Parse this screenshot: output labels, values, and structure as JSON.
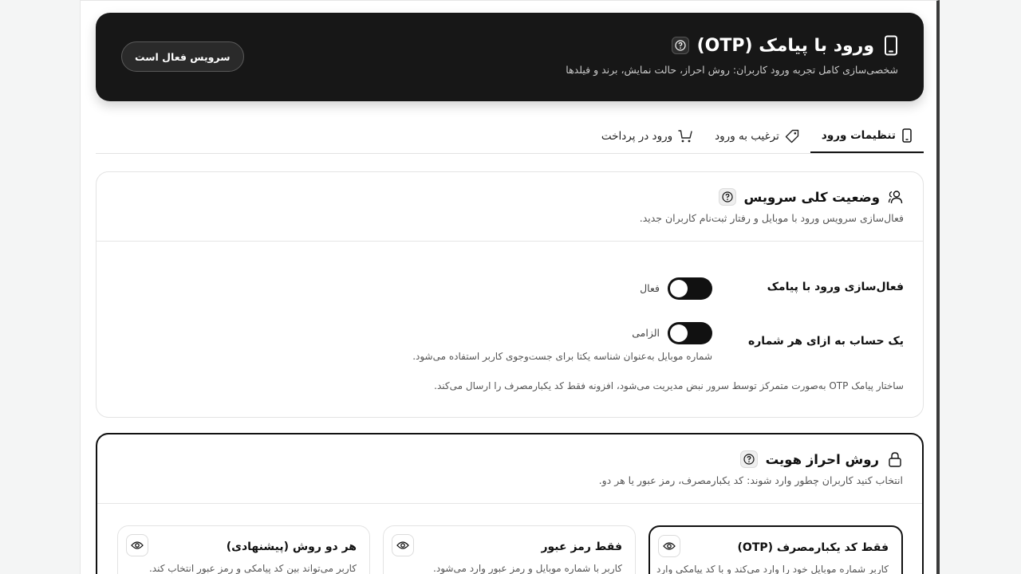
{
  "hero": {
    "title": "ورود با پیامک (OTP)",
    "subtitle": "شخصی‌سازی کامل تجربه ورود کاربران: روش احراز، حالت نمایش، برند و فیلدها",
    "service_button": "سرویس فعال است",
    "title_icon": "phone-icon",
    "help_icon": "help-icon"
  },
  "tabs": [
    {
      "label": "تنظیمات ورود",
      "icon": "phone-icon",
      "active": true
    },
    {
      "label": "ترغیب به ورود",
      "icon": "tag-icon",
      "active": false
    },
    {
      "label": "ورود در پرداخت",
      "icon": "cart-icon",
      "active": false
    }
  ],
  "service_card": {
    "title": "وضعیت کلی سرویس",
    "description": "فعال‌سازی سرویس ورود با موبایل و رفتار ثبت‌نام کاربران جدید.",
    "icon": "users-icon",
    "settings": [
      {
        "label": "فعال‌سازی ورود با پیامک",
        "toggle_text": "فعال",
        "on": true
      },
      {
        "label": "یک حساب به ازای هر شماره",
        "toggle_text": "الزامی",
        "on": true,
        "hint": "شماره موبایل به‌عنوان شناسه یکتا برای جست‌وجوی کاربر استفاده می‌شود."
      }
    ],
    "footer_note": "ساختار پیامک OTP به‌صورت متمرکز توسط سرور نبض مدیریت می‌شود، افزونه فقط کد یکبارمصرف را ارسال می‌کند."
  },
  "auth_card": {
    "title": "روش احراز هویت",
    "description": "انتخاب کنید کاربران چطور وارد شوند: کد یکبارمصرف، رمز عبور یا هر دو.",
    "icon": "lock-icon",
    "options": [
      {
        "title": "فقط کد یکبارمصرف (OTP)",
        "desc": "کاربر شماره موبایل خود را وارد می‌کند و با کد پیامکی وارد",
        "selected": true
      },
      {
        "title": "فقط رمز عبور",
        "desc": "کاربر با شماره موبایل و رمز عبور وارد می‌شود.",
        "selected": false
      },
      {
        "title": "هر دو روش (پیشنهادی)",
        "desc": "کاربر می‌تواند بین کد پیامکی و رمز عبور انتخاب کند.",
        "selected": false
      }
    ]
  },
  "colors": {
    "dark": "#171717",
    "accent": "#111111",
    "border": "#e3e3e3"
  }
}
